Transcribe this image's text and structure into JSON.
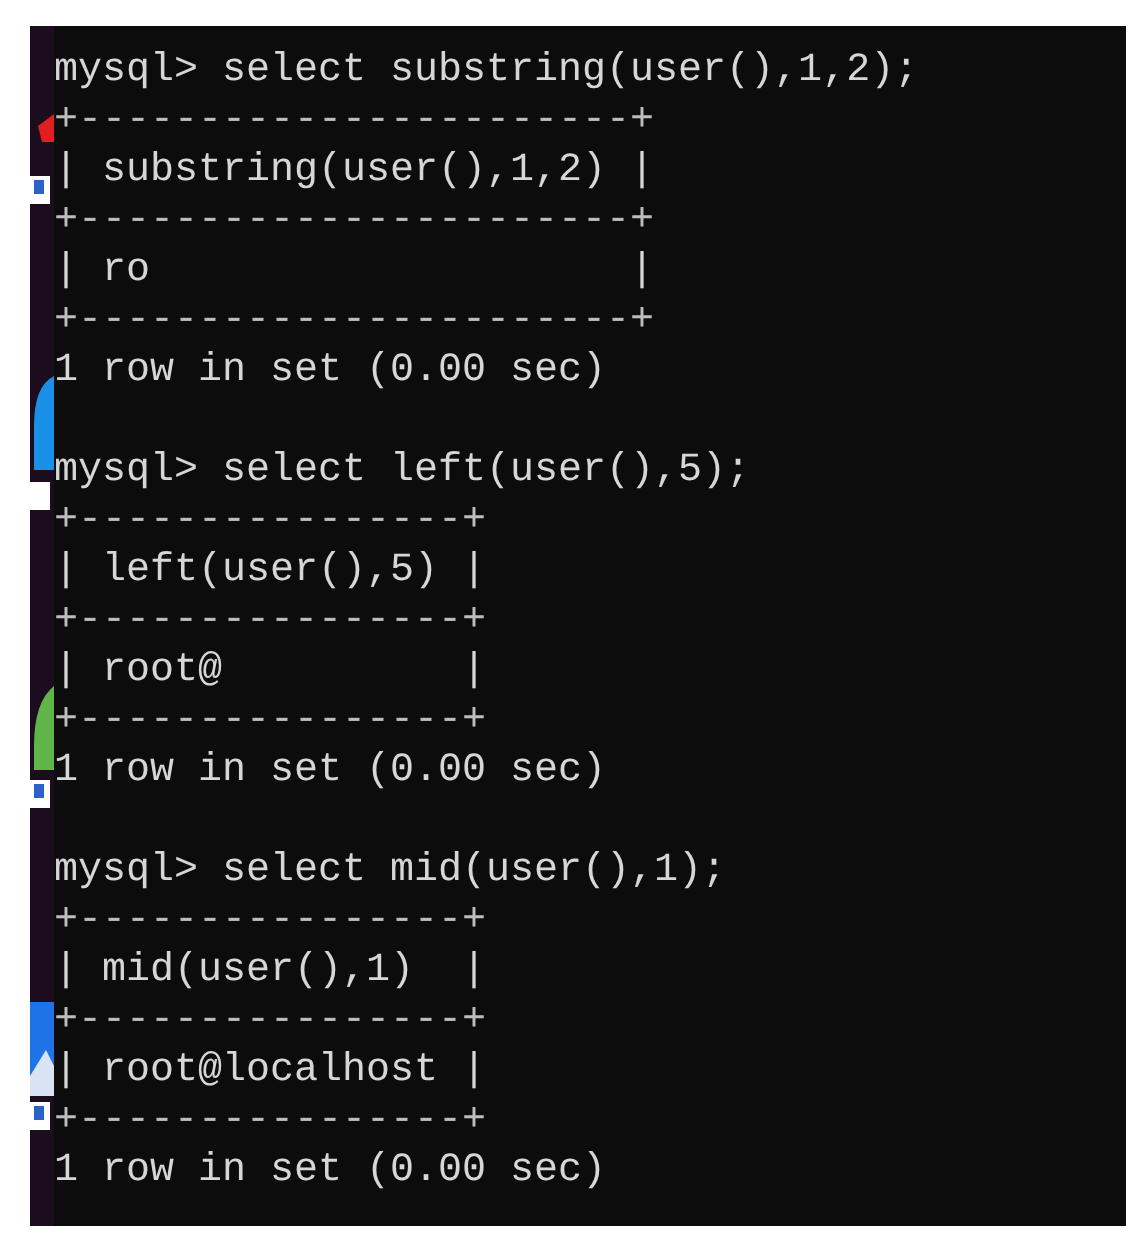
{
  "terminal": {
    "blocks": [
      {
        "command": "mysql> select substring(user(),1,2);",
        "table": {
          "border": "+-----------------------+",
          "header": "| substring(user(),1,2) |",
          "rows": [
            "| ro                    |"
          ]
        },
        "status": "1 row in set (0.00 sec)"
      },
      {
        "command": "mysql> select left(user(),5);",
        "table": {
          "border": "+----------------+",
          "header": "| left(user(),5) |",
          "rows": [
            "| root@          |"
          ]
        },
        "status": "1 row in set (0.00 sec)"
      },
      {
        "command": "mysql> select mid(user(),1);",
        "table": {
          "border": "+----------------+",
          "header": "| mid(user(),1)  |",
          "rows": [
            "| root@localhost |"
          ]
        },
        "status": "1 row in set (0.00 sec)"
      }
    ]
  }
}
